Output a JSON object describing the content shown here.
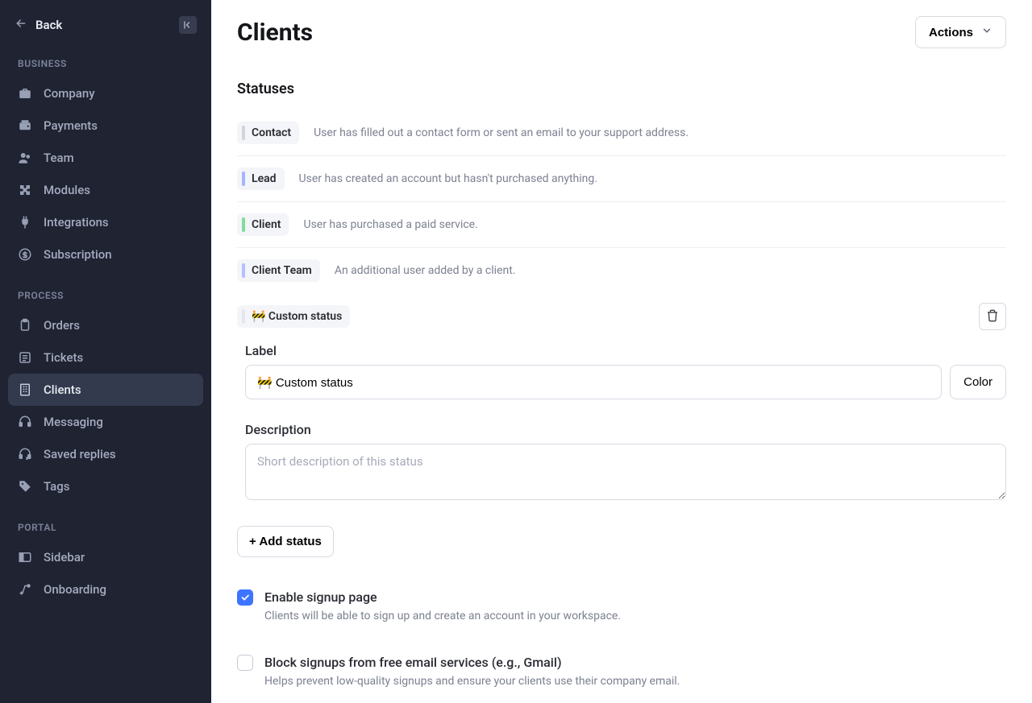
{
  "back_label": "Back",
  "sidebar": {
    "sections": [
      {
        "header": "BUSINESS",
        "items": [
          {
            "label": "Company",
            "icon": "briefcase-icon"
          },
          {
            "label": "Payments",
            "icon": "wallet-icon"
          },
          {
            "label": "Team",
            "icon": "users-icon"
          },
          {
            "label": "Modules",
            "icon": "puzzle-icon"
          },
          {
            "label": "Integrations",
            "icon": "plug-icon"
          },
          {
            "label": "Subscription",
            "icon": "dollar-circle-icon"
          }
        ]
      },
      {
        "header": "PROCESS",
        "items": [
          {
            "label": "Orders",
            "icon": "clipboard-icon"
          },
          {
            "label": "Tickets",
            "icon": "note-icon"
          },
          {
            "label": "Clients",
            "icon": "building-icon",
            "active": true
          },
          {
            "label": "Messaging",
            "icon": "headset-icon"
          },
          {
            "label": "Saved replies",
            "icon": "reply-icon"
          },
          {
            "label": "Tags",
            "icon": "tag-icon"
          }
        ]
      },
      {
        "header": "PORTAL",
        "items": [
          {
            "label": "Sidebar",
            "icon": "panel-icon"
          },
          {
            "label": "Onboarding",
            "icon": "route-icon"
          }
        ]
      }
    ]
  },
  "page": {
    "title": "Clients",
    "actions_label": "Actions"
  },
  "statuses": {
    "header": "Statuses",
    "rows": [
      {
        "name": "Contact",
        "color": "#d0d4de",
        "desc": "User has filled out a contact form or sent an email to your support address."
      },
      {
        "name": "Lead",
        "color": "#a7b4ff",
        "desc": "User has created an account but hasn't purchased anything."
      },
      {
        "name": "Client",
        "color": "#7edc9e",
        "desc": "User has purchased a paid service."
      },
      {
        "name": "Client Team",
        "color": "#b3bfff",
        "desc": "An additional user added by a client."
      }
    ]
  },
  "custom_status": {
    "pill_label": "🚧 Custom status",
    "pill_color": "#e3e6ee",
    "label_field": "Label",
    "label_value": "🚧 Custom status",
    "color_button": "Color",
    "description_field": "Description",
    "description_placeholder": "Short description of this status"
  },
  "add_status_label": "+ Add status",
  "checkboxes": [
    {
      "checked": true,
      "title": "Enable signup page",
      "sub": "Clients will be able to sign up and create an account in your workspace."
    },
    {
      "checked": false,
      "title": "Block signups from free email services (e.g., Gmail)",
      "sub": "Helps prevent low-quality signups and ensure your clients use their company email."
    }
  ]
}
